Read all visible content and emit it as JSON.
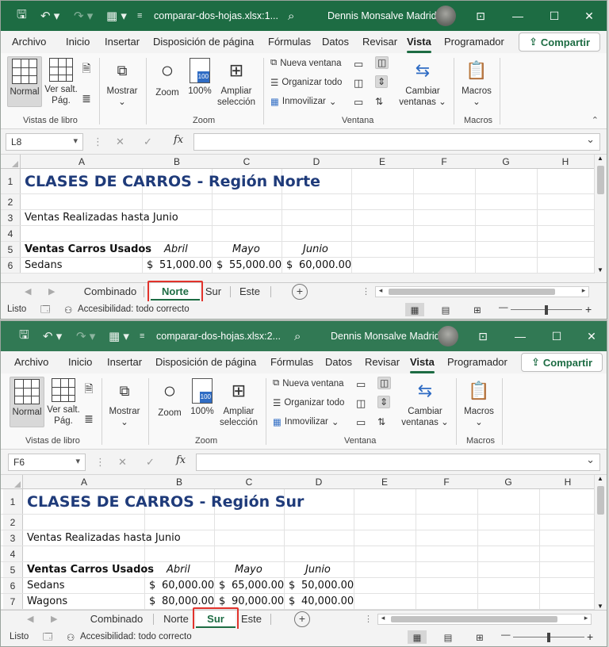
{
  "menu": [
    "Archivo",
    "Inicio",
    "Insertar",
    "Disposición de página",
    "Fórmulas",
    "Datos",
    "Revisar",
    "Vista",
    "Programador"
  ],
  "share": "Compartir",
  "user": "Dennis Monsalve Madrid",
  "ribbon": {
    "normal": "Normal",
    "ver_salt_1": "Ver salt.",
    "ver_salt_2": "Pág.",
    "mostrar": "Mostrar",
    "vistas": "Vistas de libro",
    "zoom": "Zoom",
    "pct": "100%",
    "pct_icon": "100",
    "ampliar_1": "Ampliar",
    "ampliar_2": "selección",
    "zoom_group": "Zoom",
    "nueva": "Nueva ventana",
    "organizar": "Organizar todo",
    "inmovilizar": "Inmovilizar",
    "ventana_group": "Ventana",
    "cambiar_1": "Cambiar",
    "cambiar_2": "ventanas",
    "macros": "Macros",
    "macros_group": "Macros"
  },
  "columns": [
    "A",
    "B",
    "C",
    "D",
    "E",
    "F",
    "G",
    "H"
  ],
  "tabs": [
    "Combinado",
    "Norte",
    "Sur",
    "Este"
  ],
  "status": {
    "listo": "Listo",
    "accesibilidad": "Accesibilidad: todo correcto"
  },
  "window1": {
    "title": "comparar-dos-hojas.xlsx:1...",
    "namebox": "L8",
    "active_tab": "Norte",
    "rows": [
      "1",
      "2",
      "3",
      "4",
      "5",
      "6"
    ],
    "cells": {
      "a1": "CLASES DE CARROS - Región Norte",
      "a3": "Ventas Realizadas hasta Junio",
      "a5": "Ventas Carros Usados",
      "b5": "Abril",
      "c5": "Mayo",
      "d5": "Junio",
      "a6": "Sedans",
      "b6": "51,000.00",
      "c6": "55,000.00",
      "d6": "60,000.00"
    }
  },
  "window2": {
    "title": "comparar-dos-hojas.xlsx:2...",
    "namebox": "F6",
    "active_tab": "Sur",
    "rows": [
      "1",
      "2",
      "3",
      "4",
      "5",
      "6",
      "7"
    ],
    "cells": {
      "a1": "CLASES DE CARROS - Región Sur",
      "a3": "Ventas Realizadas hasta Junio",
      "a5": "Ventas Carros Usados",
      "b5": "Abril",
      "c5": "Mayo",
      "d5": "Junio",
      "a6": "Sedans",
      "b6": "60,000.00",
      "c6": "65,000.00",
      "d6": "50,000.00",
      "a7": "Wagons",
      "b7": "80,000.00",
      "c7": "90,000.00",
      "d7": "40,000.00"
    }
  },
  "currency": "$",
  "colors": {
    "excel_green": "#1d6c43",
    "title_blue": "#1f3b7a",
    "highlight_red": "#e2332c"
  }
}
